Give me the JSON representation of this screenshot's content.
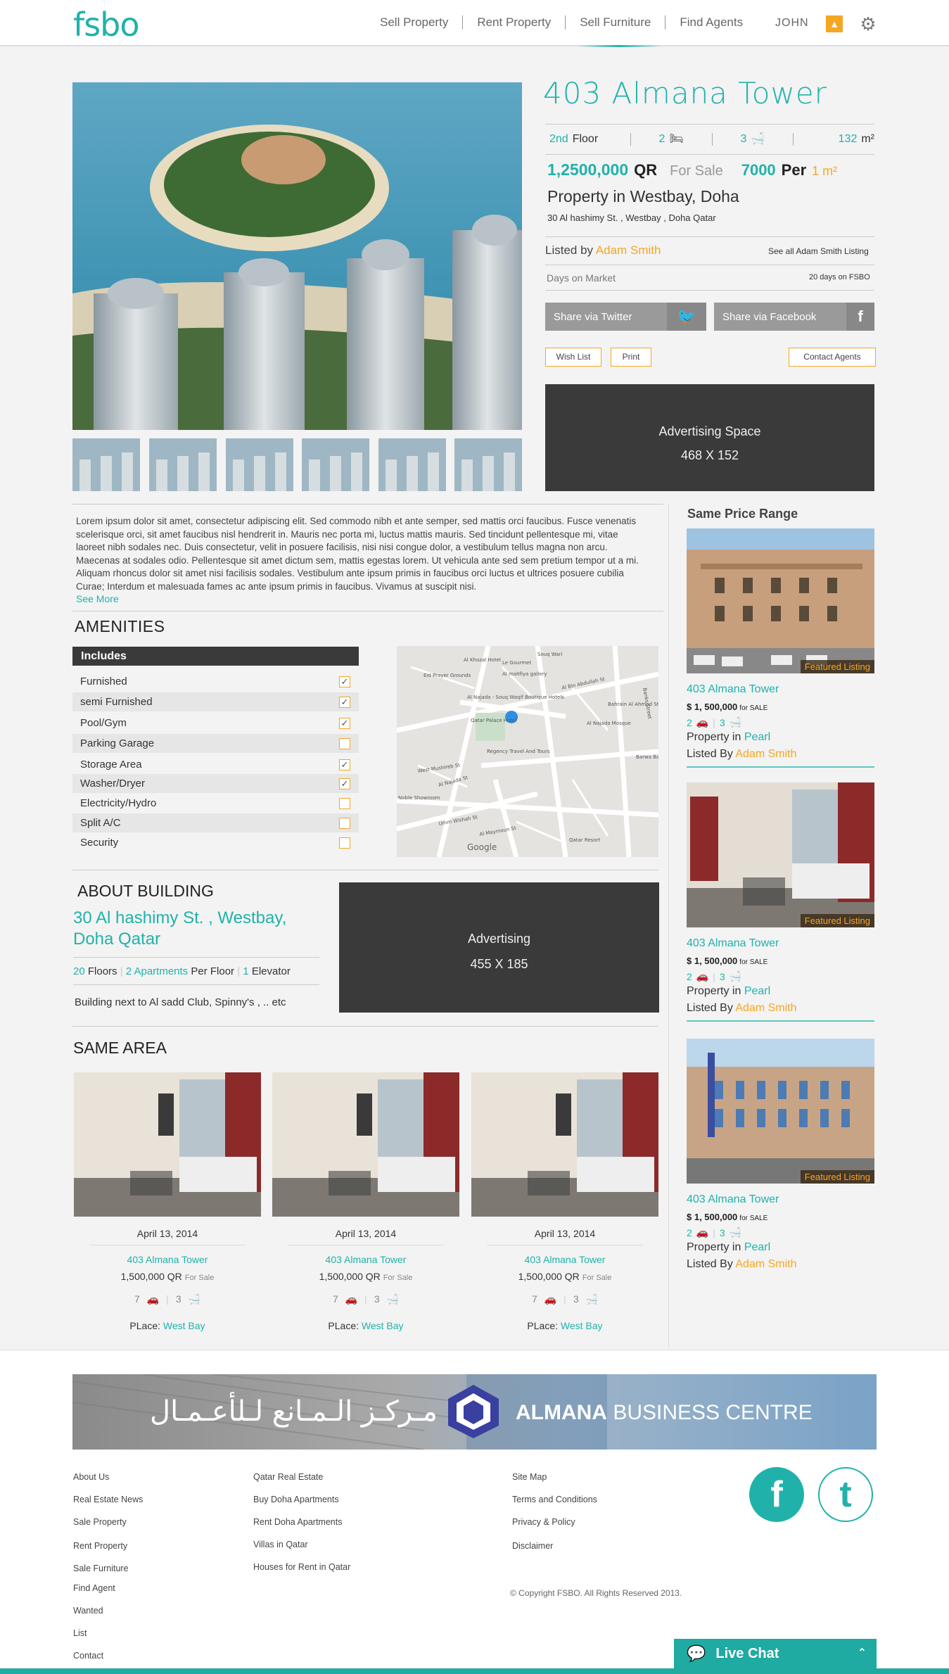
{
  "header": {
    "logo": "fsbo",
    "nav": [
      "Sell Property",
      "Rent Property",
      "Sell Furniture",
      "Find Agents"
    ],
    "user": "JOHN"
  },
  "property": {
    "title": "403  Almana  Tower",
    "floor_num": "2nd",
    "floor_label": "Floor",
    "bedrooms": "2",
    "bathrooms": "3",
    "area": "132",
    "area_unit": "m²",
    "price": "1,2500,000",
    "currency": "QR",
    "status": "For Sale",
    "price_per_sqm": "7000",
    "per_label": "Per",
    "sqm_label": "1 m²",
    "location": "Property in Westbay, Doha",
    "address": "30 Al hashimy St. , Westbay , Doha Qatar",
    "listed_by_label": "Listed by",
    "agent": "Adam Smith",
    "see_all": "See all Adam Smith Listing",
    "days_label": "Days on Market",
    "days_value": "20 days on FSBO"
  },
  "actions": {
    "share_twitter": "Share via Twitter",
    "share_facebook": "Share via Facebook",
    "wish_list": "Wish List",
    "print": "Print",
    "contact_agents": "Contact Agents"
  },
  "ad_top": {
    "label": "Advertising Space",
    "size": "468 X 152"
  },
  "description": {
    "text": "Lorem ipsum dolor sit amet, consectetur adipiscing elit. Sed commodo nibh et ante semper, sed mattis orci faucibus. Fusce venenatis scelerisque orci, sit amet faucibus nisl hendrerit in. Mauris nec porta mi, luctus mattis mauris. Sed tincidunt pellentesque mi, vitae laoreet nibh sodales nec. Duis consectetur, velit in posuere facilisis, nisi nisi congue dolor, a vestibulum tellus magna non arcu. Maecenas at sodales odio. Pellentesque sit amet dictum sem, mattis egestas lorem. Ut vehicula ante sed sem pretium tempor ut a mi. Aliquam rhoncus dolor sit amet nisi facilisis sodales. Vestibulum ante ipsum primis in faucibus orci luctus et ultrices posuere cubilia Curae; Interdum et malesuada fames ac ante ipsum primis in faucibus. Vivamus at suscipit nisi.",
    "see_more": "See More"
  },
  "amenities": {
    "title": "AMENITIES",
    "header": "Includes",
    "items": [
      {
        "label": "Furnished",
        "checked": true
      },
      {
        "label": "semi Furnished",
        "checked": true
      },
      {
        "label": "Pool/Gym",
        "checked": true
      },
      {
        "label": "Parking Garage",
        "checked": false
      },
      {
        "label": "Storage Area",
        "checked": true
      },
      {
        "label": "Washer/Dryer",
        "checked": true
      },
      {
        "label": "Electricity/Hydro",
        "checked": false
      },
      {
        "label": "Split A/C",
        "checked": false
      },
      {
        "label": "Security",
        "checked": false
      }
    ]
  },
  "map": {
    "labels": [
      "Al Khozal Hotel",
      "Eid Prayer Grounds",
      "Al Najada - Souq Waqif Boutique Hotels",
      "Le Gourmet",
      "Souq Wari",
      "Al mahfiya gallery",
      "Al Bin Abdullah St",
      "Qatar Palace Hotel",
      "Al Najada Mosque",
      "Banks Street",
      "Bahrain Al Ahmed Stores",
      "Regency Travel And Tours",
      "West Mushireb St",
      "Al Najada St",
      "Barwa Bank",
      "Noble Showroom",
      "Umm Wishah St",
      "Al Maymoun St",
      "Qatar Resort",
      "Google"
    ]
  },
  "about": {
    "title": "ABOUT BUILDING",
    "address": "30 Al hashimy St. , Westbay, Doha Qatar",
    "floors_num": "20",
    "floors_label": "Floors",
    "apts": "2 Apartments",
    "per_floor": "Per Floor",
    "elevator_num": "1",
    "elevator_label": "Elevator",
    "note": "Building next to  Al sadd Club, Spinny's , .. etc"
  },
  "ad_middle": {
    "label": "Advertising",
    "size": "455 X 185"
  },
  "same_area": {
    "title": "SAME AREA",
    "cards": [
      {
        "date": "April 13, 2014",
        "name": "403 Almana Tower",
        "price": "1,500,000 QR",
        "status": "For Sale",
        "beds": "7",
        "baths": "3",
        "place_label": "PLace:",
        "place": "West Bay"
      },
      {
        "date": "April 13, 2014",
        "name": "403 Almana Tower",
        "price": "1,500,000 QR",
        "status": "For Sale",
        "beds": "7",
        "baths": "3",
        "place_label": "PLace:",
        "place": "West Bay"
      },
      {
        "date": "April 13, 2014",
        "name": "403 Almana Tower",
        "price": "1,500,000 QR",
        "status": "For Sale",
        "beds": "7",
        "baths": "3",
        "place_label": "PLace:",
        "place": "West Bay"
      }
    ]
  },
  "sidebar": {
    "title": "Same Price Range",
    "cards": [
      {
        "featured": "Featured Listing",
        "name": "403 Almana Tower",
        "price": "$ 1, 500,000",
        "status": "for SALE",
        "beds": "2",
        "baths": "3",
        "prop_label": "Property in",
        "place": "Pearl",
        "listed_label": "Listed By",
        "agent": "Adam Smith"
      },
      {
        "featured": "Featured Listing",
        "name": "403 Almana Tower",
        "price": "$ 1, 500,000",
        "status": "for SALE",
        "beds": "2",
        "baths": "3",
        "prop_label": "Property in",
        "place": "Pearl",
        "listed_label": "Listed By",
        "agent": "Adam Smith"
      },
      {
        "featured": "Featured Listing",
        "name": "403 Almana Tower",
        "price": "$ 1, 500,000",
        "status": "for SALE",
        "beds": "2",
        "baths": "3",
        "prop_label": "Property in",
        "place": "Pearl",
        "listed_label": "Listed By",
        "agent": "Adam Smith"
      }
    ]
  },
  "banner": {
    "arabic": "مـركـز الـمـانع لـلأعـمـال",
    "brand_bold": "ALMANA",
    "brand_rest": " BUSINESS CENTRE"
  },
  "footer": {
    "col1": [
      "About Us",
      "Real Estate News",
      "Sale Property",
      "Rent Property",
      "Sale Furniture",
      "Find Agent",
      "Wanted",
      "List",
      "Contact"
    ],
    "col2": [
      "Qatar Real Estate",
      "Buy Doha Apartments",
      "Rent Doha Apartments",
      "Villas in Qatar",
      "Houses for Rent in Qatar"
    ],
    "col3": [
      "Site Map",
      "Terms and Conditions",
      "Privacy & Policy",
      "Disclaimer"
    ],
    "copyright": "© Copyright FSBO. All Rights Reserved 2013."
  },
  "live_chat": "Live Chat",
  "colors": {
    "accent": "#20b2aa",
    "highlight": "#f5a623",
    "dark": "#3a3a3a"
  }
}
